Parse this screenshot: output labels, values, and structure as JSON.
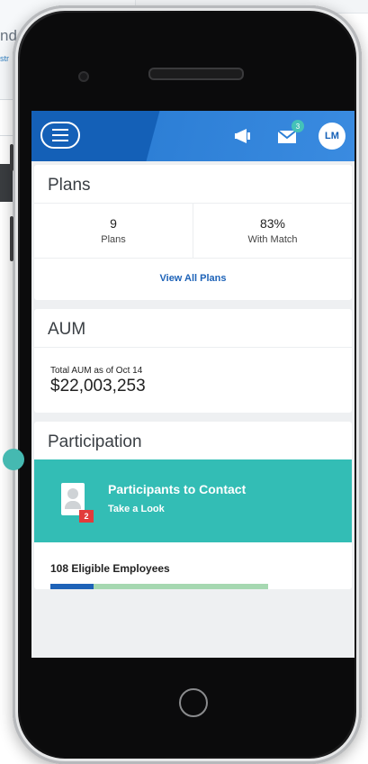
{
  "background": {
    "partial_text": "nde",
    "partial_link": "str"
  },
  "header": {
    "menu_icon": "hamburger-icon",
    "announce_icon": "megaphone-icon",
    "mail_icon": "mail-icon",
    "mail_badge": "3",
    "avatar_initials": "LM"
  },
  "plans": {
    "title": "Plans",
    "stats": [
      {
        "value": "9",
        "label": "Plans"
      },
      {
        "value": "83%",
        "label": "With Match"
      }
    ],
    "view_all": "View All Plans"
  },
  "aum": {
    "title": "AUM",
    "label": "Total AUM as of Oct 14",
    "value": "$22,003,253"
  },
  "participation": {
    "title": "Participation",
    "contact_title": "Participants to Contact",
    "contact_subtitle": "Take a Look",
    "contact_badge": "2",
    "eligible_text": "108 Eligible Employees",
    "progress_fraction": 0.2
  },
  "colors": {
    "brand_blue": "#1460b7",
    "teal": "#33bdb5",
    "progress_track": "#a6d8b1",
    "badge_red": "#e23b3b"
  }
}
